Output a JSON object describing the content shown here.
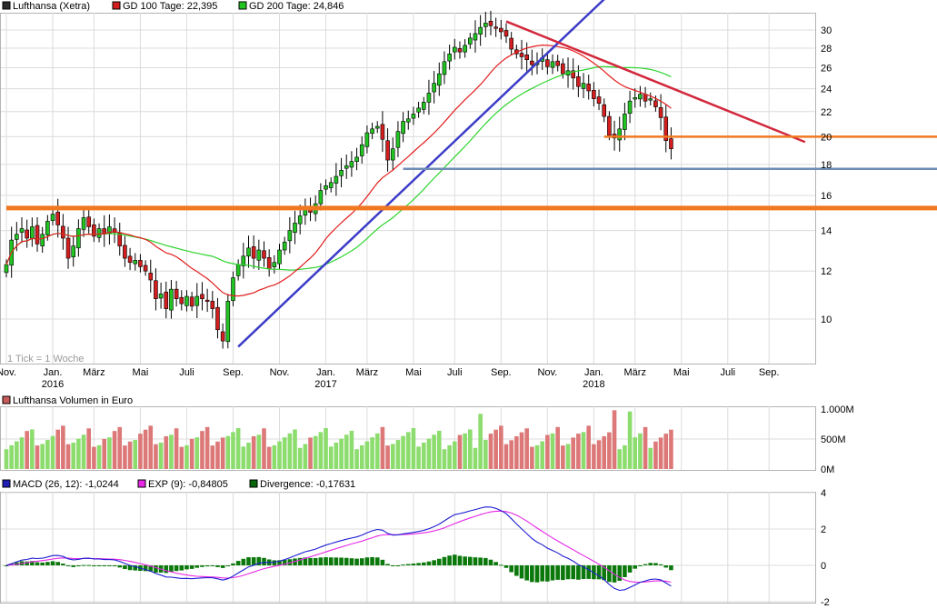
{
  "header": {
    "main_legend": [
      {
        "label": "Lufthansa (Xetra)",
        "color": "#2a2a2a"
      },
      {
        "label": "GD 100 Tage: 22,395",
        "color": "#d21e1e"
      },
      {
        "label": "GD 200 Tage: 24,846",
        "color": "#22c422"
      }
    ],
    "volume_legend": {
      "label": "Lufthansa Volumen in Euro",
      "color": "#c85a5a"
    },
    "macd_legend": [
      {
        "label": "MACD (26, 12): -1,0244",
        "color": "#1e1eb4"
      },
      {
        "label": "EXP (9): -0,84805",
        "color": "#e628e6"
      },
      {
        "label": "Divergence: -0,17631",
        "color": "#0a640a"
      }
    ],
    "tick_note": "1 Tick = 1 Woche"
  },
  "colors": {
    "up": "#22c422",
    "down": "#d21e1e",
    "grid": "#dcdcdc",
    "ma100": "#e21e1e",
    "ma200": "#2ed42e",
    "support_orange": "#f07820",
    "support_blue": "#6e8cb4",
    "trend_up": "#3c3cc8",
    "trend_down": "#d2283c",
    "macd": "#1e1ed2",
    "signal": "#e628e6",
    "divergence": "#0a780a",
    "vol_up": "#8cdc6e",
    "vol_down": "#dc7878"
  },
  "chart_data": [
    {
      "type": "candlestick",
      "title": "Lufthansa (Xetra)",
      "y_ticks": [
        10,
        12,
        14,
        16,
        18,
        20,
        22,
        24,
        26,
        28,
        30
      ],
      "ylim": [
        8.5,
        31.6
      ],
      "y_scale": "log",
      "x_labels": [
        {
          "label": "Nov.",
          "week": 0
        },
        {
          "label": "Jan.",
          "week": 9
        },
        {
          "label": "März",
          "week": 17
        },
        {
          "label": "Mai",
          "week": 26
        },
        {
          "label": "Juli",
          "week": 35
        },
        {
          "label": "Sep.",
          "week": 44
        },
        {
          "label": "Nov.",
          "week": 53
        },
        {
          "label": "Jan.",
          "week": 62
        },
        {
          "label": "März",
          "week": 70
        },
        {
          "label": "Mai",
          "week": 79
        },
        {
          "label": "Juli",
          "week": 87
        },
        {
          "label": "Sep.",
          "week": 96
        },
        {
          "label": "Nov.",
          "week": 105
        },
        {
          "label": "Jan.",
          "week": 114
        },
        {
          "label": "März",
          "week": 122
        },
        {
          "label": "Mai",
          "week": 131
        },
        {
          "label": "Juli",
          "week": 140
        },
        {
          "label": "Sep.",
          "week": 148
        }
      ],
      "year_labels": [
        {
          "label": "2016",
          "week": 9
        },
        {
          "label": "2017",
          "week": 62
        },
        {
          "label": "2018",
          "week": 114
        }
      ],
      "weeks": 156,
      "close": [
        12.3,
        13.5,
        13.8,
        14.1,
        13.6,
        14.2,
        13.3,
        13.8,
        14.5,
        14.9,
        14.3,
        13.6,
        12.6,
        13.2,
        14.1,
        14.7,
        14.2,
        13.7,
        14.1,
        13.8,
        14.2,
        13.9,
        13.2,
        12.6,
        12.4,
        12.5,
        12.2,
        12.0,
        11.6,
        10.8,
        11.0,
        10.4,
        11.2,
        10.8,
        10.6,
        10.9,
        10.5,
        10.9,
        10.8,
        10.7,
        10.4,
        9.6,
        9.2,
        10.7,
        11.7,
        12.3,
        12.7,
        13.1,
        12.6,
        13.0,
        12.6,
        12.1,
        12.4,
        13.0,
        13.4,
        14.0,
        14.4,
        14.8,
        15.2,
        15.0,
        15.5,
        16.3,
        16.6,
        16.8,
        17.2,
        17.6,
        17.9,
        18.2,
        18.5,
        19.4,
        20.3,
        20.6,
        20.8,
        19.8,
        18.3,
        19.1,
        20.4,
        21.2,
        21.4,
        21.8,
        22.3,
        22.8,
        23.6,
        24.5,
        25.4,
        26.6,
        27.4,
        28.1,
        27.6,
        28.3,
        29.1,
        29.6,
        30.3,
        30.8,
        30.5,
        30.2,
        29.8,
        29.3,
        27.9,
        27.4,
        27.1,
        26.8,
        26.3,
        26.5,
        27.0,
        26.1,
        26.6,
        26.2,
        25.4,
        25.7,
        25.0,
        24.2,
        24.5,
        23.8,
        23.1,
        22.7,
        21.6,
        20.1,
        19.9,
        20.6,
        21.8,
        22.9,
        23.2,
        23.5,
        22.9,
        23.1,
        22.4,
        21.5,
        19.7,
        19.1
      ],
      "series": [
        {
          "name": "GD 100 Tage",
          "last": 22.395
        },
        {
          "name": "GD 200 Tage",
          "last": 24.846
        }
      ],
      "lines": [
        {
          "kind": "trend",
          "from": [
            45,
            9.0
          ],
          "to": [
            118,
            35.0
          ]
        },
        {
          "kind": "trend",
          "from": [
            97,
            31.0
          ],
          "to": [
            155,
            19.6
          ]
        },
        {
          "kind": "horizontal",
          "y": 15.25,
          "from_week": 0
        },
        {
          "kind": "horizontal",
          "y": 20.0,
          "from_week": 116
        },
        {
          "kind": "horizontal",
          "y": 17.7,
          "from_week": 77
        }
      ]
    },
    {
      "type": "bar",
      "title": "Lufthansa Volumen in Euro",
      "y_ticks": [
        "1.000M",
        "500M",
        "0M"
      ],
      "ylim": [
        0,
        1000
      ],
      "unit": "M"
    },
    {
      "type": "line",
      "title": "MACD",
      "y_ticks": [
        4,
        2,
        0,
        -2
      ],
      "ylim": [
        -2,
        4
      ],
      "series": [
        {
          "name": "MACD (26, 12)",
          "last": -1.0244
        },
        {
          "name": "EXP (9)",
          "last": -0.84805
        },
        {
          "name": "Divergence",
          "last": -0.17631
        }
      ]
    }
  ]
}
